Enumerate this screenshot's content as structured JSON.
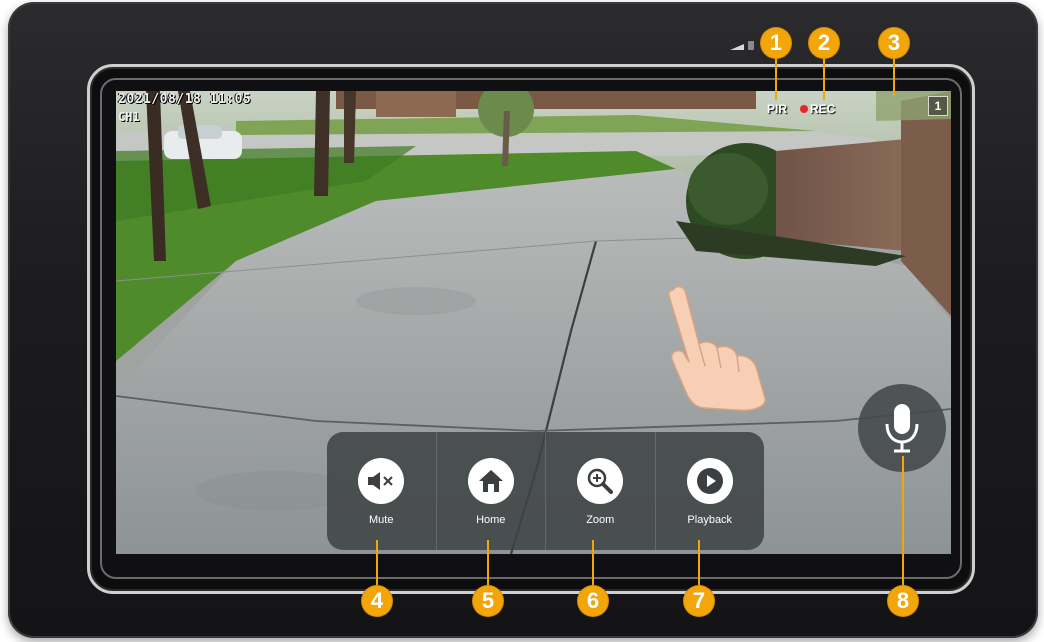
{
  "osd": {
    "timestamp": "2021/08/18 11:05",
    "channel": "CH1",
    "pir_label": "PIR",
    "rec_label": "REC",
    "page_indicator": "1"
  },
  "controls": [
    {
      "label": "Mute",
      "icon": "speaker-mute-icon"
    },
    {
      "label": "Home",
      "icon": "home-icon"
    },
    {
      "label": "Zoom",
      "icon": "zoom-in-icon"
    },
    {
      "label": "Playback",
      "icon": "play-icon"
    }
  ],
  "mic": {
    "icon": "microphone-icon"
  },
  "callouts": [
    "1",
    "2",
    "3",
    "4",
    "5",
    "6",
    "7",
    "8"
  ],
  "colors": {
    "callout": "#f2a60a",
    "rec_dot": "#e8262a",
    "device_body": "#1c1c1e",
    "control_bar": "#3e4244"
  }
}
